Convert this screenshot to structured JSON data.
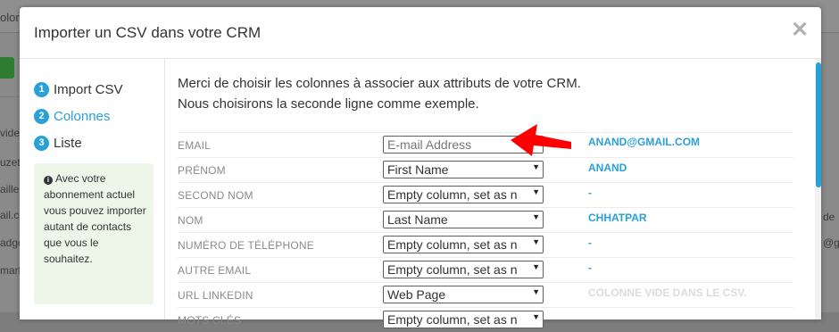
{
  "modal": {
    "title": "Importer un CSV dans votre CRM",
    "close_glyph": "✕"
  },
  "steps": [
    {
      "num": "1",
      "label": "Import CSV"
    },
    {
      "num": "2",
      "label": "Colonnes"
    },
    {
      "num": "3",
      "label": "Liste"
    }
  ],
  "info": {
    "text": "Avec votre abonnement actuel vous pouvez importer autant de contacts que vous le souhaitez."
  },
  "intro": {
    "line1": "Merci de choisir les colonnes à associer aux attributs de votre CRM.",
    "line2": "Nous choisirons la seconde ligne comme exemple."
  },
  "mapping": [
    {
      "label": "EMAIL",
      "select": "E-mail Address",
      "example": "ANAND@GMAIL.COM"
    },
    {
      "label": "PRÉNOM",
      "select": "First Name",
      "example": "ANAND"
    },
    {
      "label": "SECOND NOM",
      "select": "Empty column, set as n",
      "example": "-"
    },
    {
      "label": "NOM",
      "select": "Last Name",
      "example": "CHHATPAR"
    },
    {
      "label": "NUMÉRO DE TÉLÉPHONE",
      "select": "Empty column, set as n",
      "example": "-"
    },
    {
      "label": "AUTRE EMAIL",
      "select": "Empty column, set as n",
      "example": "-"
    },
    {
      "label": "URL LINKEDIN",
      "select": "Web Page",
      "example": "COLONNE VIDE DANS LE CSV."
    },
    {
      "label": "MOTS CLÉS",
      "select": "Empty column, set as n",
      "example": ""
    }
  ],
  "colors": {
    "accent": "#2aa0d8",
    "arrow": "#ff0000",
    "info_bg": "#eef6ea"
  },
  "background_fragments": {
    "top": "olora",
    "left": [
      "vider",
      "uzet",
      "aille@",
      "ail.co",
      "adge",
      "mark"
    ],
    "right": [
      "de",
      "@gr"
    ]
  }
}
